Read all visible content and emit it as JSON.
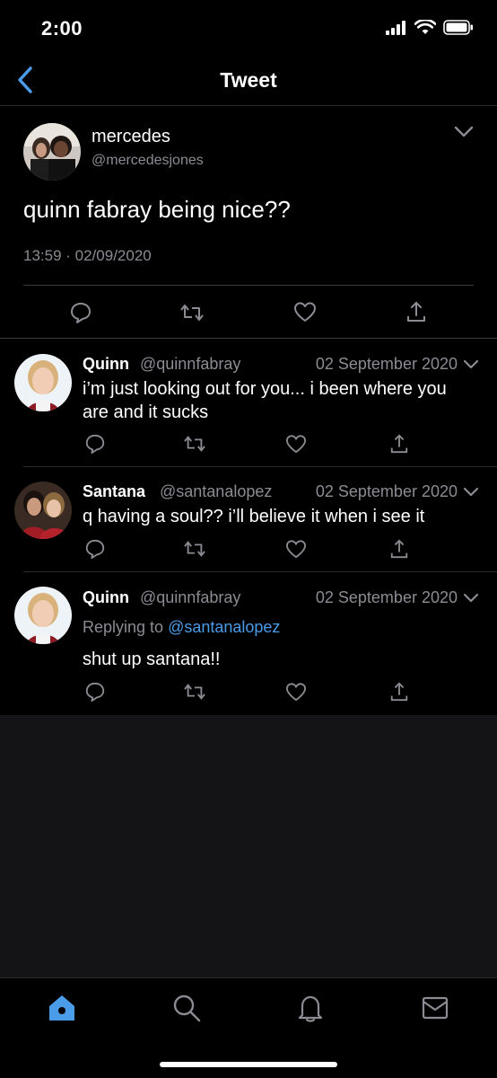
{
  "status_bar": {
    "time": "2:00"
  },
  "nav": {
    "title": "Tweet"
  },
  "main_tweet": {
    "name": "mercedes",
    "handle": "@mercedesjones",
    "text": "quinn fabray being nice??",
    "timestamp": "13:59 · 02/09/2020"
  },
  "replies": [
    {
      "name": "Quinn",
      "handle": "@quinnfabray",
      "date": "02 September 2020",
      "text": "i’m just looking out for you... i been where you are and it sucks"
    },
    {
      "name": "Santana",
      "handle": "@santanalopez",
      "date": "02 September 2020",
      "text": "q having a soul?? i’ll believe it when i see it"
    },
    {
      "name": "Quinn",
      "handle": "@quinnfabray",
      "date": "02 September 2020",
      "replying_prefix": "Replying to",
      "replying_to": "@santanalopez",
      "text": "shut up santana!!"
    }
  ],
  "icons": {
    "reply": "reply-icon",
    "retweet": "retweet-icon",
    "like": "like-icon",
    "share": "share-icon",
    "home": "home-icon",
    "search": "search-icon",
    "notifications": "bell-icon",
    "messages": "mail-icon"
  },
  "colors": {
    "accent": "#4a9be8",
    "background": "#000000",
    "secondary_text": "#8b8b93"
  }
}
